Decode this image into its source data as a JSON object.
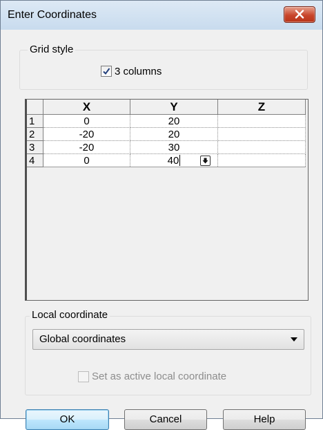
{
  "window": {
    "title": "Enter Coordinates"
  },
  "grid_style": {
    "group_label": "Grid style",
    "three_columns": {
      "label": "3 columns",
      "checked": true
    }
  },
  "grid": {
    "columns": [
      "X",
      "Y",
      "Z"
    ],
    "rows": [
      {
        "num": "1",
        "x": "0",
        "y": "20",
        "z": ""
      },
      {
        "num": "2",
        "x": "-20",
        "y": "20",
        "z": ""
      },
      {
        "num": "3",
        "x": "-20",
        "y": "30",
        "z": ""
      },
      {
        "num": "4",
        "x": "0",
        "y": "40",
        "z": ""
      }
    ]
  },
  "local_coordinate": {
    "group_label": "Local coordinate",
    "selected": "Global coordinates",
    "set_active": {
      "label": "Set as active local coordinate",
      "checked": false,
      "enabled": false
    }
  },
  "buttons": {
    "ok": "OK",
    "cancel": "Cancel",
    "help": "Help"
  },
  "icons": {
    "close": "close-icon",
    "check": "checkmark-icon",
    "cell_button": "down-arrow-icon",
    "combo_arrow": "chevron-down-icon"
  }
}
